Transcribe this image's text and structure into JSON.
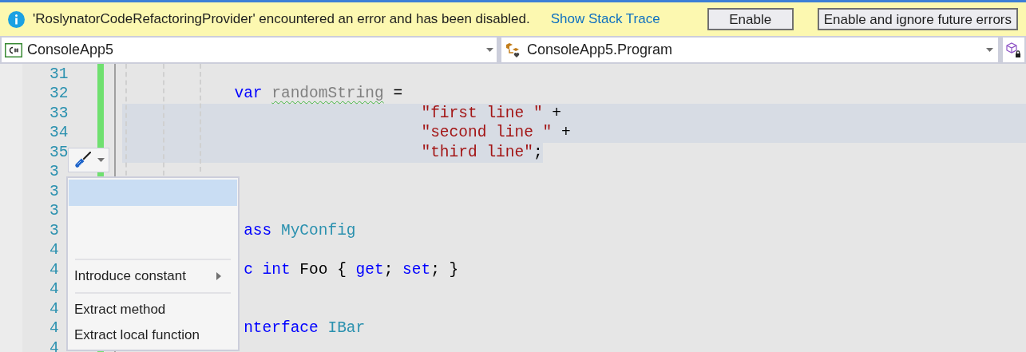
{
  "infobar": {
    "message": "'RoslynatorCodeRefactoringProvider' encountered an error and has been disabled.",
    "link": "Show Stack Trace",
    "buttons": [
      "Enable",
      "Enable and ignore future errors"
    ]
  },
  "navbar": {
    "project": "ConsoleApp5",
    "type": "ConsoleApp5.Program"
  },
  "editor": {
    "lines": [
      {
        "number": "31",
        "selected": false
      },
      {
        "number": "32",
        "selected": false,
        "segments": [
          {
            "text": "            var ",
            "kind": "keyword"
          },
          {
            "text": "randomString",
            "kind": "unused"
          },
          {
            "text": " =",
            "kind": "plain"
          }
        ]
      },
      {
        "number": "33",
        "selected": true,
        "segments": [
          {
            "text": "                                \"first line \"",
            "kind": "string"
          },
          {
            "text": " +",
            "kind": "plain"
          }
        ]
      },
      {
        "number": "34",
        "selected": true,
        "segments": [
          {
            "text": "                                \"second line \"",
            "kind": "string"
          },
          {
            "text": " +",
            "kind": "plain"
          }
        ]
      },
      {
        "number": "35",
        "selected": true,
        "segments": [
          {
            "text": "                                \"third line\"",
            "kind": "string"
          },
          {
            "text": ";",
            "kind": "plain"
          }
        ]
      },
      {
        "number": "3",
        "selected": false
      },
      {
        "number": "3",
        "selected": false
      },
      {
        "number": "3",
        "selected": false
      },
      {
        "number": "3",
        "selected": false,
        "segments": [
          {
            "text": "             ass ",
            "kind": "keyword"
          },
          {
            "text": "MyConfig",
            "kind": "type"
          }
        ]
      },
      {
        "number": "4",
        "selected": false
      },
      {
        "number": "4",
        "selected": false,
        "segments": [
          {
            "text": "             c int",
            "kind": "keyword"
          },
          {
            "text": " Foo { ",
            "kind": "plain"
          },
          {
            "text": "get",
            "kind": "keyword"
          },
          {
            "text": "; ",
            "kind": "plain"
          },
          {
            "text": "set",
            "kind": "keyword"
          },
          {
            "text": "; }",
            "kind": "plain"
          }
        ]
      },
      {
        "number": "4",
        "selected": false
      },
      {
        "number": "4",
        "selected": false
      },
      {
        "number": "4",
        "selected": false,
        "segments": [
          {
            "text": "             nterface ",
            "kind": "keyword"
          },
          {
            "text": "IBar",
            "kind": "type"
          }
        ]
      },
      {
        "number": "4",
        "selected": false
      }
    ]
  },
  "quick_actions_menu": {
    "items": [
      {
        "kind": "blank",
        "selected": true
      },
      {
        "kind": "separator"
      },
      {
        "kind": "submenu",
        "label": "Introduce constant",
        "selected": false
      },
      {
        "kind": "separator"
      },
      {
        "kind": "action",
        "label": "Extract method",
        "selected": false
      },
      {
        "kind": "action",
        "label": "Extract local function",
        "selected": false
      }
    ]
  }
}
